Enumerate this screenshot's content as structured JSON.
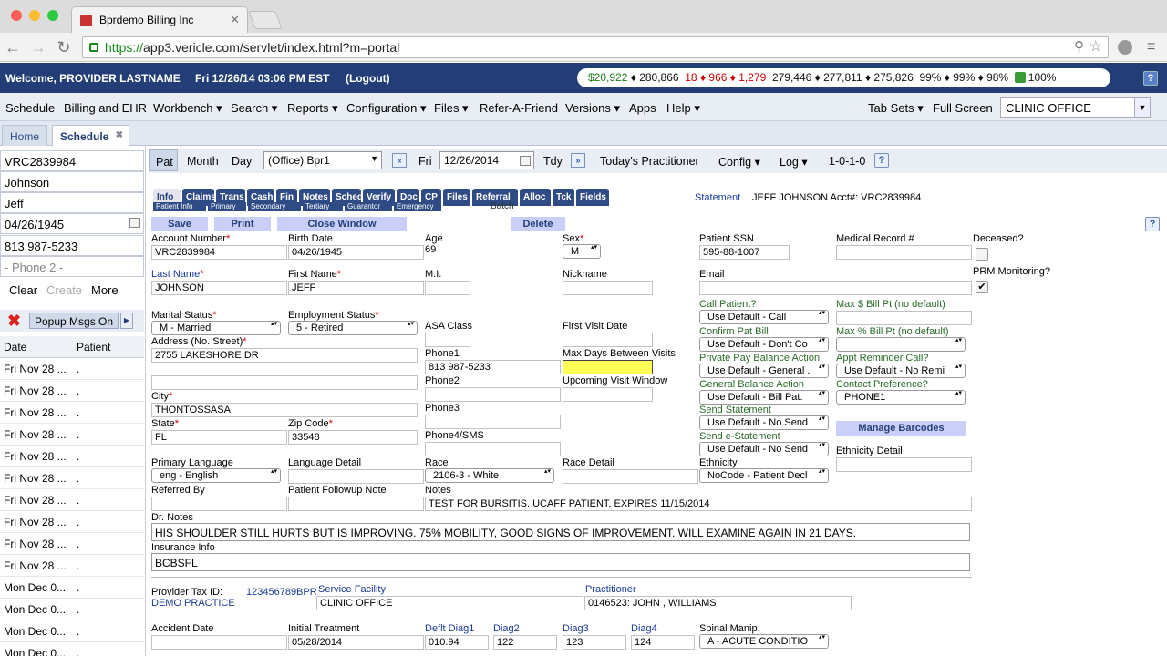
{
  "browser": {
    "tab_title": "Bprdemo Billing Inc",
    "tab_close": "✕",
    "url_scheme": "https://",
    "url_rest": "app3.vericle.com/servlet/index.html?m=portal"
  },
  "header": {
    "welcome": "Welcome, PROVIDER LASTNAME",
    "datetime": "Fri 12/26/14 03:06 PM EST",
    "logout": "(Logout)",
    "stats": {
      "s1": "$20,922",
      "s2": "♦ 280,866",
      "s3": "18",
      "s4": "♦ 966",
      "s5": "♦ 1,279",
      "s6": "279,446 ♦ 277,811 ♦ 275,826",
      "s7": "99% ♦ 99% ♦ 98%",
      "s8": "100%"
    },
    "help": "?"
  },
  "menu": {
    "items": [
      "Schedule",
      "Billing and EHR",
      "Workbench ▾",
      "Search ▾",
      "Reports ▾",
      "Configuration ▾",
      "Files ▾",
      "Refer-A-Friend",
      "Versions ▾",
      "Apps",
      "Help ▾"
    ],
    "tab_sets": "Tab Sets ▾",
    "full_screen": "Full Screen",
    "clinic": "CLINIC OFFICE"
  },
  "app_tabs": {
    "home": "Home",
    "schedule": "Schedule",
    "close": "✖"
  },
  "left": {
    "fields": [
      "VRC2839984",
      "Johnson",
      "Jeff",
      "04/26/1945",
      "813 987-5233",
      "- Phone 2 -"
    ],
    "clear": "Clear",
    "create": "Create",
    "more": "More",
    "popup": "Popup Msgs On",
    "col_date": "Date",
    "col_patient": "Patient",
    "rows": [
      "Fri Nov 28 ...",
      "Fri Nov 28 ...",
      "Fri Nov 28 ...",
      "Fri Nov 28 ...",
      "Fri Nov 28 ...",
      "Fri Nov 28 ...",
      "Fri Nov 28 ...",
      "Fri Nov 28 ...",
      "Fri Nov 28 ...",
      "Fri Nov 28 ...",
      "Mon Dec 0...",
      "Mon Dec 0...",
      "Mon Dec 0...",
      "Mon Dec 0..."
    ],
    "row_patient": "."
  },
  "toolbar": {
    "pat": "Pat",
    "month": "Month",
    "day": "Day",
    "office": "(Office) Bpr1",
    "dayname": "Fri",
    "date": "12/26/2014",
    "tdy": "Tdy",
    "practitioner": "Today's Practitioner",
    "config": "Config ▾",
    "log": "Log ▾",
    "version": "1-0-1-0",
    "help": "?"
  },
  "subtabs": [
    "Info",
    "Claims",
    "Trans",
    "Cash",
    "Fin",
    "Notes",
    "Sched",
    "Verify",
    "Doc",
    "CP",
    "Files",
    "Referral",
    "Alloc",
    "Tck",
    "Fields"
  ],
  "subtabs2": [
    "Patient Info",
    "Primary",
    "Secondary",
    "Tertiary",
    "Guarantor",
    "Emergency"
  ],
  "batch": "Batch",
  "statement_link": "Statement",
  "patient_header": "JEFF JOHNSON Acct#: VRC2839984",
  "actions": {
    "save": "Save",
    "print": "Print",
    "close": "Close Window",
    "delete": "Delete"
  },
  "form": {
    "account_number_label": "Account Number",
    "account_number": "VRC2839984",
    "birth_date_label": "Birth Date",
    "birth_date": "04/26/1945",
    "age_label": "Age",
    "age": "69",
    "sex_label": "Sex",
    "sex": "M",
    "ssn_label": "Patient SSN",
    "ssn": "595-88-1007",
    "mrn_label": "Medical Record #",
    "deceased_label": "Deceased?",
    "last_name_label": "Last Name",
    "last_name": "JOHNSON",
    "first_name_label": "First Name",
    "first_name": "JEFF",
    "mi_label": "M.I.",
    "nickname_label": "Nickname",
    "email_label": "Email",
    "prm_label": "PRM Monitoring?",
    "prm_check": "✔",
    "call_patient_label": "Call Patient?",
    "call_patient": "Use Default - Call",
    "max_bill_label": "Max $ Bill Pt (no default)",
    "marital_label": "Marital Status",
    "marital": "M - Married",
    "employment_label": "Employment Status",
    "employment": "5 - Retired",
    "asa_label": "ASA Class",
    "first_visit_label": "First Visit Date",
    "confirm_bill_label": "Confirm Pat Bill",
    "confirm_bill": "Use Default - Don't Co",
    "max_pct_label": "Max % Bill Pt (no default)",
    "address_label": "Address (No. Street)",
    "address": "2755 LAKESHORE DR",
    "phone1_label": "Phone1",
    "phone1": "813 987-5233",
    "max_days_label": "Max Days Between Visits",
    "private_pay_label": "Private Pay Balance Action",
    "private_pay": "Use Default - General .",
    "appt_reminder_label": "Appt Reminder Call?",
    "appt_reminder": "Use Default - No Remi",
    "phone2_label": "Phone2",
    "upcoming_label": "Upcoming Visit Window",
    "general_balance_label": "General Balance Action",
    "general_balance": "Use Default - Bill Pat.",
    "contact_pref_label": "Contact Preference?",
    "contact_pref": "PHONE1",
    "city_label": "City",
    "city": "THONTOSSASA",
    "phone3_label": "Phone3",
    "send_statement_label": "Send Statement",
    "send_statement": "Use Default - No Send",
    "manage_barcodes": "Manage Barcodes",
    "state_label": "State",
    "state": "FL",
    "zip_label": "Zip Code",
    "zip": "33548",
    "phone4_label": "Phone4/SMS",
    "send_estatement_label": "Send e-Statement",
    "send_estatement": "Use Default - No Send",
    "ethnicity_detail_label": "Ethnicity Detail",
    "language_label": "Primary Language",
    "language": "eng - English",
    "language_detail_label": "Language Detail",
    "race_label": "Race",
    "race": "2106-3 - White",
    "race_detail_label": "Race Detail",
    "ethnicity_label": "Ethnicity",
    "ethnicity": "NoCode - Patient Decl",
    "referred_label": "Referred By",
    "followup_label": "Patient Followup Note",
    "notes_label": "Notes",
    "notes": "TEST FOR BURSITIS. UCAFF PATIENT, EXPIRES 11/15/2014",
    "dr_notes_label": "Dr. Notes",
    "dr_notes": "HIS SHOULDER STILL HURTS BUT IS IMPROVING. 75% MOBILITY, GOOD SIGNS OF IMPROVEMENT. WILL EXAMINE AGAIN IN 21 DAYS.",
    "insurance_label": "Insurance Info",
    "insurance": "BCBSFL",
    "tax_id_label": "Provider Tax ID:",
    "tax_id": "123456789BPR",
    "demo_practice": "DEMO PRACTICE",
    "service_facility_label": "Service Facility",
    "service_facility": "CLINIC OFFICE",
    "practitioner_label": "Practitioner",
    "practitioner": "0146523: JOHN , WILLIAMS",
    "accident_label": "Accident Date",
    "initial_treatment_label": "Initial Treatment",
    "initial_treatment": "05/28/2014",
    "diag1_label": "Deflt Diag1",
    "diag1": "010.94",
    "diag2_label": "Diag2",
    "diag2": "122",
    "diag3_label": "Diag3",
    "diag3": "123",
    "diag4_label": "Diag4",
    "diag4": "124",
    "spinal_label": "Spinal Manip.",
    "spinal": "A - ACUTE CONDITIO"
  }
}
